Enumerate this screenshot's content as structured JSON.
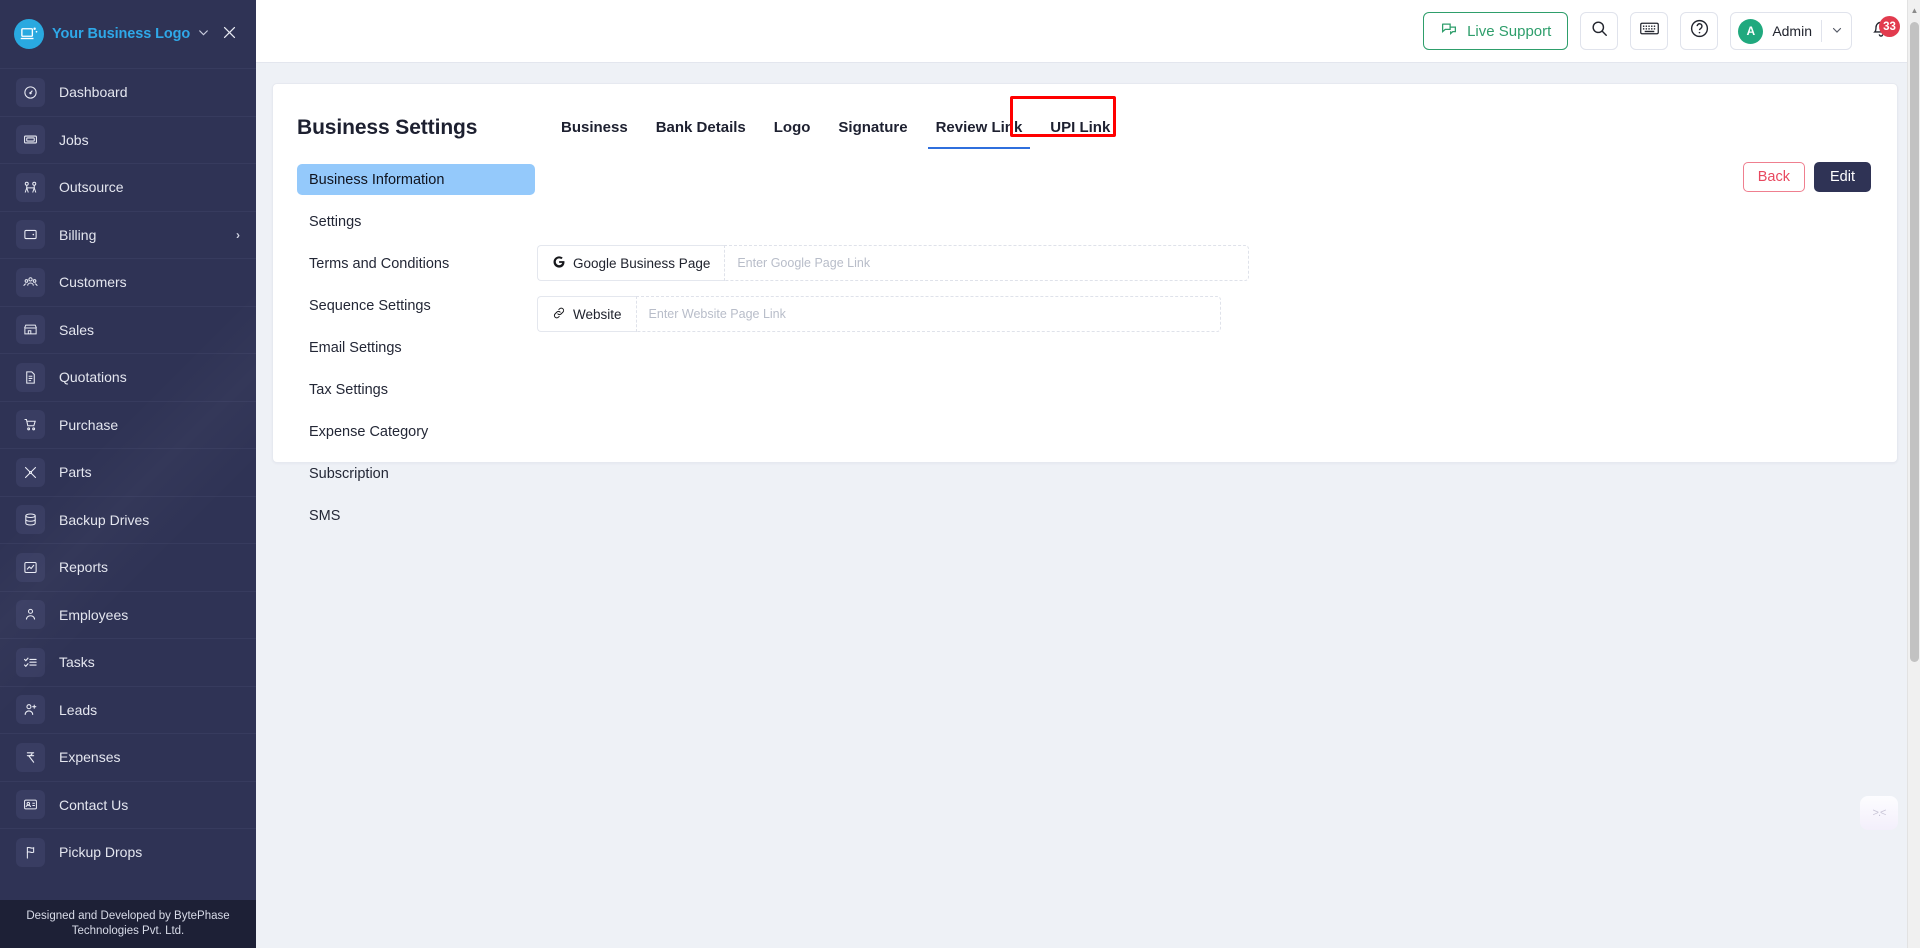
{
  "sidebar": {
    "brand": {
      "name": "Your Business Logo",
      "caret": "chevron-down",
      "close": "×"
    },
    "items": [
      {
        "label": "Dashboard",
        "icon": "gauge-icon"
      },
      {
        "label": "Jobs",
        "icon": "ticket-icon"
      },
      {
        "label": "Outsource",
        "icon": "outsource-icon"
      },
      {
        "label": "Billing",
        "icon": "wallet-icon",
        "chevron": "›"
      },
      {
        "label": "Customers",
        "icon": "people-icon"
      },
      {
        "label": "Sales",
        "icon": "store-icon"
      },
      {
        "label": "Quotations",
        "icon": "document-icon"
      },
      {
        "label": "Purchase",
        "icon": "cart-icon"
      },
      {
        "label": "Parts",
        "icon": "parts-icon"
      },
      {
        "label": "Backup Drives",
        "icon": "database-icon"
      },
      {
        "label": "Reports",
        "icon": "chart-icon"
      },
      {
        "label": "Employees",
        "icon": "employee-icon"
      },
      {
        "label": "Tasks",
        "icon": "tasklist-icon"
      },
      {
        "label": "Leads",
        "icon": "user-plus-icon"
      },
      {
        "label": "Expenses",
        "icon": "rupee-icon"
      },
      {
        "label": "Contact Us",
        "icon": "contact-card-icon"
      },
      {
        "label": "Pickup Drops",
        "icon": "pickup-icon"
      }
    ],
    "footer": "Designed and Developed by BytePhase Technologies Pvt. Ltd."
  },
  "topbar": {
    "live_support": "Live Support",
    "search_icon": "search-icon",
    "keyboard_icon": "keyboard-icon",
    "help_icon": "help-icon",
    "admin_initial": "A",
    "admin_name": "Admin",
    "notification_count": "33"
  },
  "page": {
    "title": "Business Settings",
    "settings_menu": [
      {
        "label": "Business Information",
        "active": true
      },
      {
        "label": "Settings",
        "active": false
      },
      {
        "label": "Terms and Conditions",
        "active": false
      },
      {
        "label": "Sequence Settings",
        "active": false
      },
      {
        "label": "Email Settings",
        "active": false
      },
      {
        "label": "Tax Settings",
        "active": false
      },
      {
        "label": "Expense Category",
        "active": false
      },
      {
        "label": "Subscription",
        "active": false
      },
      {
        "label": "SMS",
        "active": false
      }
    ],
    "tabs": [
      {
        "label": "Business",
        "active": false
      },
      {
        "label": "Bank Details",
        "active": false
      },
      {
        "label": "Logo",
        "active": false
      },
      {
        "label": "Signature",
        "active": false
      },
      {
        "label": "Review Link",
        "active": true,
        "highlighted": true
      },
      {
        "label": "UPI Link",
        "active": false
      }
    ],
    "actions": {
      "back": "Back",
      "edit": "Edit"
    },
    "fields": [
      {
        "label": "Google Business Page",
        "icon": "google-icon",
        "value": "",
        "placeholder": "Enter Google Page Link"
      },
      {
        "label": "Website",
        "icon": "link-icon",
        "value": "",
        "placeholder": "Enter Website Page Link"
      }
    ]
  },
  "colors": {
    "sidebar_bg": "#2f3355",
    "brand_blue": "#2fa8e8",
    "accent_blue": "#2f6fdd",
    "active_item": "#94c9fb",
    "support_green": "#2e9e6b",
    "badge_red": "#e23b4e",
    "highlight_red": "#ff0000",
    "back_red": "#e8485f",
    "edit_dark": "#2f3355"
  }
}
